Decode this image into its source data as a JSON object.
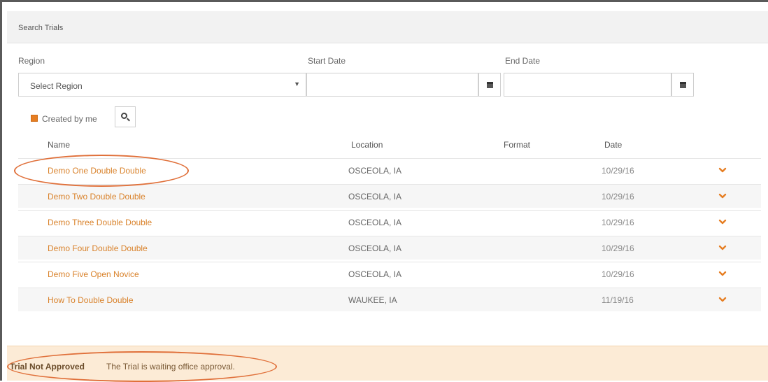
{
  "panel": {
    "title": "Search Trials"
  },
  "filters": {
    "region_label": "Region",
    "region_value": "Select Region",
    "start_date_label": "Start Date",
    "start_date_value": "",
    "end_date_label": "End Date",
    "end_date_value": "",
    "created_by_me_label": "Created by me",
    "created_by_me_checked": true
  },
  "table": {
    "columns": [
      "Name",
      "Location",
      "Format",
      "Date"
    ],
    "rows": [
      {
        "name": "Demo One Double Double",
        "location": "OSCEOLA, IA",
        "format": "",
        "date": "10/29/16"
      },
      {
        "name": "Demo Two Double Double",
        "location": "OSCEOLA, IA",
        "format": "",
        "date": "10/29/16"
      },
      {
        "name": "Demo Three Double Double",
        "location": "OSCEOLA, IA",
        "format": "",
        "date": "10/29/16"
      },
      {
        "name": "Demo Four Double Double",
        "location": "OSCEOLA, IA",
        "format": "",
        "date": "10/29/16"
      },
      {
        "name": "Demo Five Open Novice",
        "location": "OSCEOLA, IA",
        "format": "",
        "date": "10/29/16"
      },
      {
        "name": "How To Double Double",
        "location": "WAUKEE, IA",
        "format": "",
        "date": "11/19/16"
      }
    ]
  },
  "alert": {
    "title": "Trial Not Approved",
    "message": "The Trial is waiting office approval."
  },
  "colors": {
    "accent": "#e67e22",
    "link": "#d9822b",
    "alert_bg": "#fcebd6",
    "annotation": "#e0703a"
  }
}
